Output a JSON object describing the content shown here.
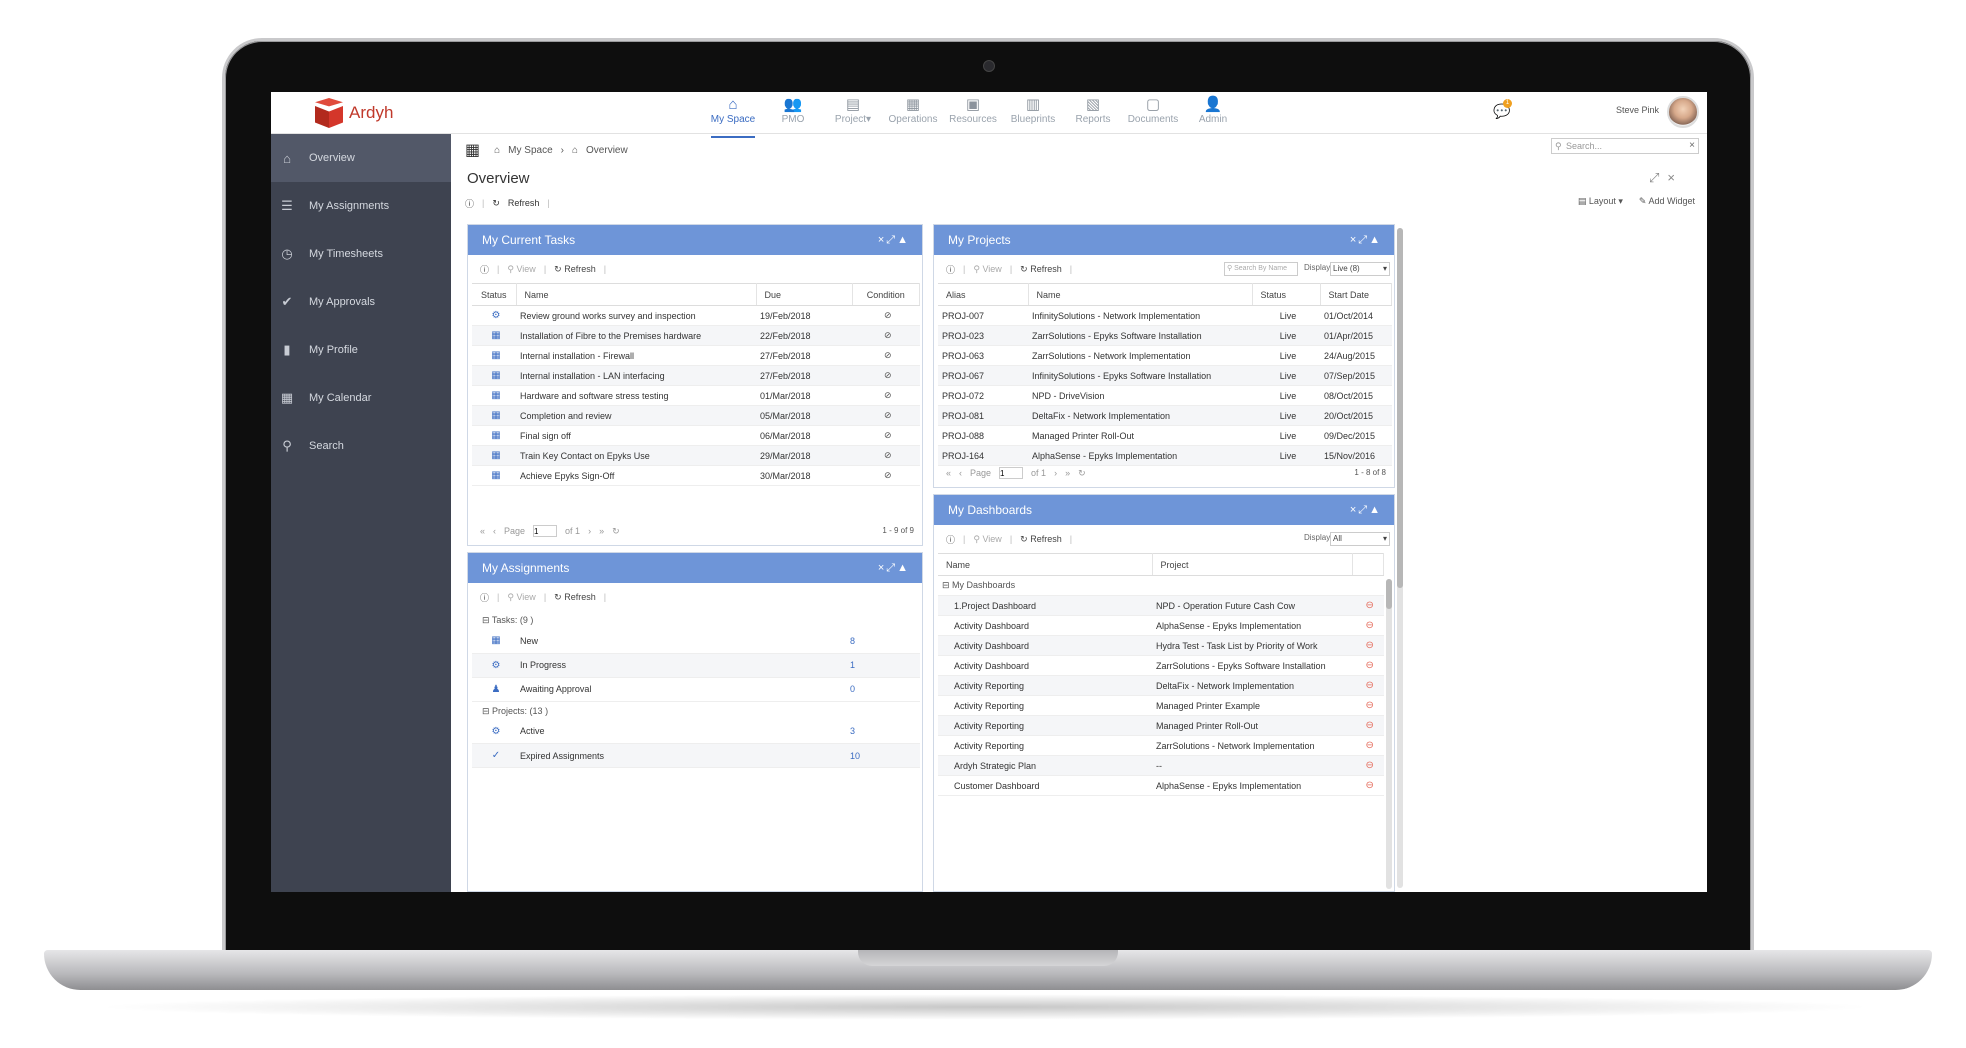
{
  "app": {
    "name": "Ardyh"
  },
  "nav": [
    {
      "label": "My Space",
      "icon": "home-icon",
      "active": true
    },
    {
      "label": "PMO",
      "icon": "people-icon"
    },
    {
      "label": "Project",
      "icon": "project-icon",
      "caret": "▾"
    },
    {
      "label": "Operations",
      "icon": "operations-icon"
    },
    {
      "label": "Resources",
      "icon": "resources-icon"
    },
    {
      "label": "Blueprints",
      "icon": "blueprints-icon"
    },
    {
      "label": "Reports",
      "icon": "reports-icon"
    },
    {
      "label": "Documents",
      "icon": "documents-icon"
    },
    {
      "label": "Admin",
      "icon": "admin-icon"
    }
  ],
  "user": {
    "name": "Steve Pink",
    "notifications": "1"
  },
  "search": {
    "placeholder": "Search..."
  },
  "sidebar": [
    {
      "label": "Overview",
      "icon": "home-icon",
      "active": true
    },
    {
      "label": "My Assignments",
      "icon": "assignments-icon"
    },
    {
      "label": "My Timesheets",
      "icon": "clock-icon"
    },
    {
      "label": "My Approvals",
      "icon": "check-circle-icon"
    },
    {
      "label": "My Profile",
      "icon": "profile-icon"
    },
    {
      "label": "My Calendar",
      "icon": "calendar-icon"
    },
    {
      "label": "Search",
      "icon": "search-icon"
    }
  ],
  "breadcrumb": [
    "My Space",
    "Overview"
  ],
  "page": {
    "title": "Overview",
    "refresh": "Refresh",
    "layout": "Layout",
    "add_widget": "Add Widget"
  },
  "common": {
    "view": "View",
    "refresh": "Refresh",
    "page": "Page",
    "of": "of 1",
    "page_num": "1",
    "display": "Display"
  },
  "tasks": {
    "title": "My Current Tasks",
    "columns": [
      "Status",
      "Name",
      "Due",
      "Condition"
    ],
    "rows": [
      {
        "status": "gear-icon",
        "name": "Review ground works survey and inspection",
        "due": "19/Feb/2018"
      },
      {
        "status": "calendar-icon",
        "name": "Installation of Fibre to the Premises hardware",
        "due": "22/Feb/2018"
      },
      {
        "status": "calendar-icon",
        "name": "Internal installation - Firewall",
        "due": "27/Feb/2018"
      },
      {
        "status": "calendar-icon",
        "name": "Internal installation - LAN interfacing",
        "due": "27/Feb/2018"
      },
      {
        "status": "calendar-icon",
        "name": "Hardware and software stress testing",
        "due": "01/Mar/2018"
      },
      {
        "status": "calendar-icon",
        "name": "Completion and review",
        "due": "05/Mar/2018"
      },
      {
        "status": "calendar-icon",
        "name": "Final sign off",
        "due": "06/Mar/2018"
      },
      {
        "status": "calendar-icon",
        "name": "Train Key Contact on Epyks Use",
        "due": "29/Mar/2018"
      },
      {
        "status": "calendar-icon",
        "name": "Achieve Epyks Sign-Off",
        "due": "30/Mar/2018"
      }
    ],
    "count": "1 - 9 of 9"
  },
  "projects": {
    "title": "My Projects",
    "search_placeholder": "Search By Name",
    "display_value": "Live (8)",
    "columns": [
      "Alias",
      "Name",
      "Status",
      "Start Date"
    ],
    "rows": [
      {
        "alias": "PROJ-007",
        "name": "InfinitySolutions - Network Implementation",
        "status": "Live",
        "start": "01/Oct/2014"
      },
      {
        "alias": "PROJ-023",
        "name": "ZarrSolutions - Epyks Software Installation",
        "status": "Live",
        "start": "01/Apr/2015"
      },
      {
        "alias": "PROJ-063",
        "name": "ZarrSolutions - Network Implementation",
        "status": "Live",
        "start": "24/Aug/2015"
      },
      {
        "alias": "PROJ-067",
        "name": "InfinitySolutions - Epyks Software Installation",
        "status": "Live",
        "start": "07/Sep/2015"
      },
      {
        "alias": "PROJ-072",
        "name": "NPD - DriveVision",
        "status": "Live",
        "start": "08/Oct/2015"
      },
      {
        "alias": "PROJ-081",
        "name": "DeltaFix - Network Implementation",
        "status": "Live",
        "start": "20/Oct/2015"
      },
      {
        "alias": "PROJ-088",
        "name": "Managed Printer Roll-Out",
        "status": "Live",
        "start": "09/Dec/2015"
      },
      {
        "alias": "PROJ-164",
        "name": "AlphaSense - Epyks Implementation",
        "status": "Live",
        "start": "15/Nov/2016"
      }
    ],
    "count": "1 - 8 of 8"
  },
  "assignments": {
    "title": "My Assignments",
    "groups": [
      {
        "label": "Tasks: (9 )",
        "rows": [
          {
            "icon": "calendar-icon",
            "label": "New",
            "count": "8"
          },
          {
            "icon": "gear-icon",
            "label": "In Progress",
            "count": "1"
          },
          {
            "icon": "person-icon",
            "label": "Awaiting Approval",
            "count": "0"
          }
        ]
      },
      {
        "label": "Projects: (13 )",
        "rows": [
          {
            "icon": "gear-icon",
            "label": "Active",
            "count": "3"
          },
          {
            "icon": "check-icon",
            "label": "Expired Assignments",
            "count": "10"
          }
        ]
      }
    ]
  },
  "dashboards": {
    "title": "My Dashboards",
    "display_value": "All",
    "columns": [
      "Name",
      "Project"
    ],
    "group": "My Dashboards",
    "rows": [
      {
        "name": "1.Project Dashboard",
        "project": "NPD - Operation Future Cash Cow"
      },
      {
        "name": "Activity Dashboard",
        "project": "AlphaSense - Epyks Implementation"
      },
      {
        "name": "Activity Dashboard",
        "project": "Hydra Test - Task List by Priority of Work"
      },
      {
        "name": "Activity Dashboard",
        "project": "ZarrSolutions - Epyks Software Installation"
      },
      {
        "name": "Activity Reporting",
        "project": "DeltaFix - Network Implementation"
      },
      {
        "name": "Activity Reporting",
        "project": "Managed Printer Example"
      },
      {
        "name": "Activity Reporting",
        "project": "Managed Printer Roll-Out"
      },
      {
        "name": "Activity Reporting",
        "project": "ZarrSolutions - Network Implementation"
      },
      {
        "name": "Ardyh Strategic Plan",
        "project": "--"
      },
      {
        "name": "Customer Dashboard",
        "project": "AlphaSense - Epyks Implementation"
      }
    ]
  },
  "colors": {
    "accent": "#3b6cc2",
    "widget_header": "#6e95d8",
    "sidebar": "#3e4350",
    "brand": "#c0392b"
  }
}
